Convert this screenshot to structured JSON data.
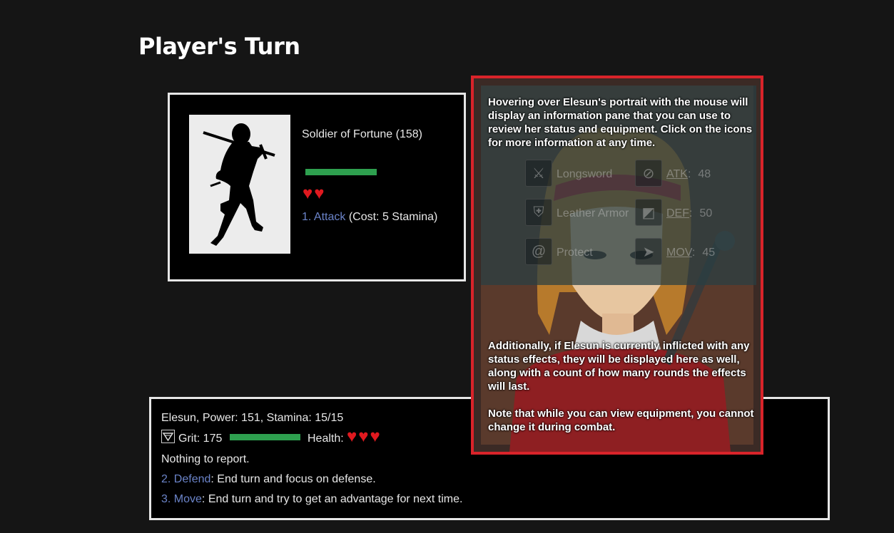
{
  "title": "Player's Turn",
  "enemy": {
    "name": "Soldier of Fortune (158)",
    "health_fraction": 1.0,
    "hearts": 2,
    "action": {
      "number": "1.",
      "name": "Attack",
      "detail": "(Cost: 5 Stamina)"
    }
  },
  "player": {
    "line1": "Elesun, Power: 151, Stamina: 15/15",
    "grit_label": "Grit: 175",
    "health_label": "Health:",
    "hearts": 3,
    "status_text": "Nothing to report.",
    "actions": [
      {
        "number": "2.",
        "name": "Defend",
        "detail": ": End turn and focus on defense."
      },
      {
        "number": "3.",
        "name": "Move",
        "detail": ": End turn and try to get an advantage for next time."
      }
    ]
  },
  "info_pane": {
    "text1": "Hovering over Elesun's portrait with the mouse will display an information pane that you can use to review her status and equipment.  Click on the icons for more information at any time.",
    "text2": "Additionally, if Elesun is currently inflicted with any status effects, they will be displayed here as well,  along with a count of how many rounds the effects will last.",
    "text3": "Note that while you can view equipment, you cannot change it during combat.",
    "equipment": [
      {
        "icon": "sword-icon",
        "name": "Longsword"
      },
      {
        "icon": "armor-icon",
        "name": "Leather Armor"
      },
      {
        "icon": "spiral-icon",
        "name": "Protect"
      }
    ],
    "stats": [
      {
        "icon": "attack-icon",
        "key": "ATK",
        "value": "48"
      },
      {
        "icon": "shield-icon",
        "key": "DEF",
        "value": "50"
      },
      {
        "icon": "move-icon",
        "key": "MOV",
        "value": "45"
      }
    ]
  },
  "colors": {
    "heart": "#e0191f",
    "bar": "#2ea04f",
    "link": "#6b84c9",
    "highlight": "#d9232a"
  }
}
